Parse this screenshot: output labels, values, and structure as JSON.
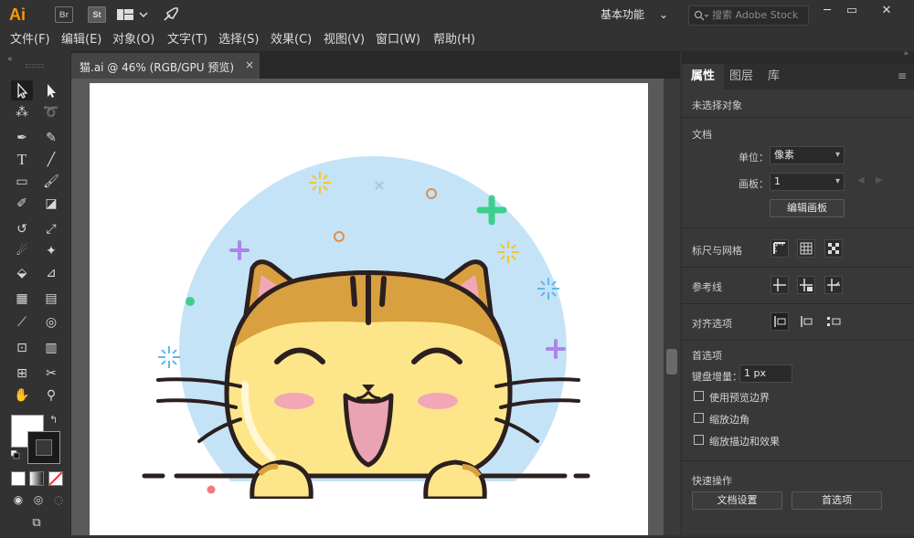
{
  "app": {
    "logo": "Ai",
    "bridge_label": "Br",
    "stock_label": "St",
    "workspace": "基本功能",
    "search_placeholder": "搜索 Adobe Stock"
  },
  "menu": [
    "文件(F)",
    "编辑(E)",
    "对象(O)",
    "文字(T)",
    "选择(S)",
    "效果(C)",
    "视图(V)",
    "窗口(W)",
    "帮助(H)"
  ],
  "document_tab": {
    "label": "猫.ai @ 46% (RGB/GPU 预览)",
    "close": "×"
  },
  "panel": {
    "tabs": [
      "属性",
      "图层",
      "库"
    ],
    "active_tab": "属性",
    "no_selection": "未选择对象",
    "document_section": "文档",
    "units_label": "单位：",
    "units_value": "像素",
    "artboard_label": "画板：",
    "artboard_value": "1",
    "edit_artboards_button": "编辑画板",
    "rulers_grids": "标尺与网格",
    "guides": "参考线",
    "align_options": "对齐选项",
    "preferences": "首选项",
    "keyboard_increment_label": "键盘增量：",
    "keyboard_increment_value": "1 px",
    "checkboxes": [
      "使用预览边界",
      "缩放边角",
      "缩放描边和效果"
    ],
    "quick_actions": "快速操作",
    "doc_setup_button": "文档设置",
    "preferences_button": "首选项"
  },
  "colors": {
    "accent_logo": "#ff9a00",
    "cat_fill": "#fde68a",
    "cat_patch": "#d9a03f",
    "bg_circle": "#c5e3f6",
    "blush": "#f2a7b6"
  }
}
